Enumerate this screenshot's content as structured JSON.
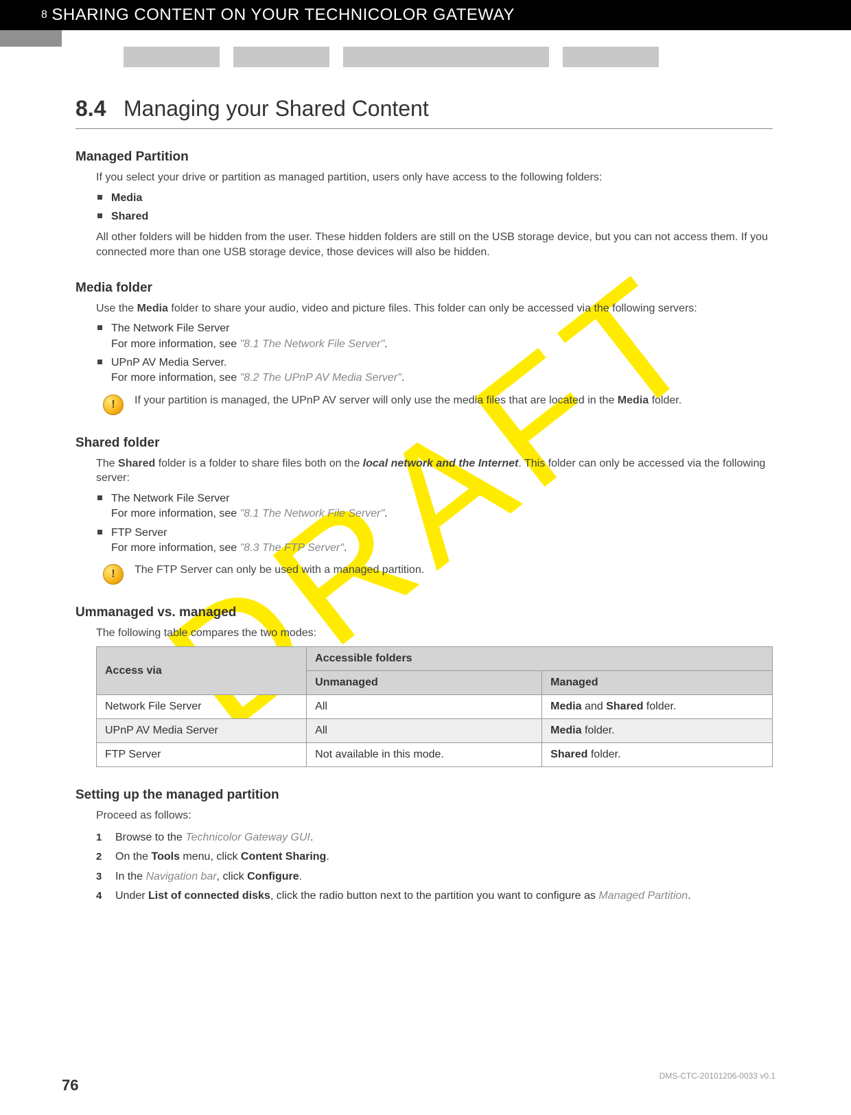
{
  "header": {
    "chapter_num": "8",
    "chapter_title": "SHARING CONTENT ON YOUR TECHNICOLOR GATEWAY"
  },
  "watermark": "DRAFT",
  "heading": {
    "num": "8.4",
    "title": "Managing your Shared Content"
  },
  "sections": {
    "managed_partition": {
      "title": "Managed Partition",
      "intro": "If you select your drive or partition as managed partition, users only have access to the following folders:",
      "bullets": [
        "Media",
        "Shared"
      ],
      "after": "All other folders will be hidden from the user. These hidden folders are still on the USB storage device, but you can not access them. If you connected more than one USB storage device, those devices will also be hidden."
    },
    "media_folder": {
      "title": "Media folder",
      "intro_pre": "Use the ",
      "intro_bold": "Media",
      "intro_post": " folder to share your audio, video and picture files. This folder can only be accessed via the following servers:",
      "b1_line1": "The Network File Server",
      "b1_line2_pre": "For more information, see ",
      "b1_line2_link": "\"8.1 The Network File Server\"",
      "b1_line2_post": ".",
      "b2_line1": "UPnP AV Media Server.",
      "b2_line2_pre": "For more information, see ",
      "b2_line2_link": "\"8.2 The UPnP AV Media Server\"",
      "b2_line2_post": ".",
      "note_pre": "If your partition is managed, the UPnP AV server will only use the media files that are located in the ",
      "note_bold": "Media",
      "note_post": " folder."
    },
    "shared_folder": {
      "title": "Shared folder",
      "intro_p1": "The ",
      "intro_b1": "Shared",
      "intro_p2": " folder is a folder to share files both on the ",
      "intro_bi": "local network and the Internet",
      "intro_p3": ". This folder can only be accessed via the following server:",
      "b1_line1": "The Network File Server",
      "b1_line2_pre": "For more information, see ",
      "b1_line2_link": "\"8.1 The Network File Server\"",
      "b1_line2_post": ".",
      "b2_line1": "FTP Server",
      "b2_line2_pre": "For more information, see ",
      "b2_line2_link": "\"8.3 The FTP Server\"",
      "b2_line2_post": ".",
      "note": "The FTP Server can only be used with a managed partition."
    },
    "compare": {
      "title": "Ummanaged vs. managed",
      "intro": "The following table compares the two modes:",
      "th_access": "Access via",
      "th_folders": "Accessible folders",
      "th_unmanaged": "Unmanaged",
      "th_managed": "Managed",
      "r1c1": "Network File Server",
      "r1c2": "All",
      "r1c3_b1": "Media",
      "r1c3_m": " and ",
      "r1c3_b2": "Shared",
      "r1c3_p": " folder.",
      "r2c1": "UPnP AV Media Server",
      "r2c2": "All",
      "r2c3_b": "Media",
      "r2c3_p": " folder.",
      "r3c1": "FTP Server",
      "r3c2": "Not available in this mode.",
      "r3c3_b": "Shared",
      "r3c3_p": " folder."
    },
    "setup": {
      "title": "Setting up the managed partition",
      "intro": "Proceed as follows:",
      "s1_pre": "Browse to the ",
      "s1_it": "Technicolor Gateway GUI",
      "s1_post": ".",
      "s2_p1": "On the ",
      "s2_b1": "Tools",
      "s2_p2": " menu, click ",
      "s2_b2": "Content Sharing",
      "s2_p3": ".",
      "s3_p1": "In the ",
      "s3_it": "Navigation bar",
      "s3_p2": ", click ",
      "s3_b": "Configure",
      "s3_p3": ".",
      "s4_p1": "Under ",
      "s4_b": "List of connected disks",
      "s4_p2": ", click the radio button next to the partition you want to configure as ",
      "s4_it": "Managed Partition",
      "s4_p3": "."
    }
  },
  "footer": {
    "page": "76",
    "docid": "DMS-CTC-20101206-0033 v0.1"
  }
}
